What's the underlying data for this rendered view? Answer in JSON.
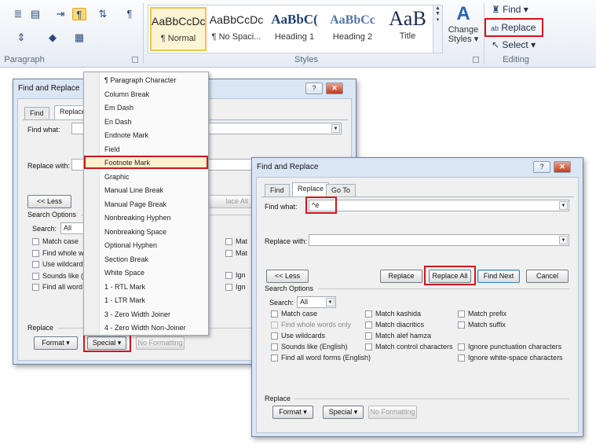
{
  "ribbon": {
    "paragraph": {
      "label": "Paragraph"
    },
    "styles": {
      "label": "Styles",
      "items": [
        {
          "sample": "AaBbCcDc",
          "name": "¶ Normal"
        },
        {
          "sample": "AaBbCcDc",
          "name": "¶ No Spaci..."
        },
        {
          "sample": "AaBbC(",
          "name": "Heading 1"
        },
        {
          "sample": "AaBbCc",
          "name": "Heading 2"
        },
        {
          "sample": "AaB",
          "name": "Title"
        }
      ],
      "change_styles_line1": "Change",
      "change_styles_line2": "Styles ▾"
    },
    "editing": {
      "label": "Editing",
      "find": "Find",
      "replace": "Replace",
      "select": "Select"
    },
    "colors": {
      "highlight_red": "#d2151b",
      "selected_style": "#f0c44c"
    }
  },
  "dialog_left": {
    "title": "Find and Replace",
    "tabs": [
      "Find",
      "Replace"
    ],
    "find_what_label": "Find what:",
    "replace_with_label": "Replace with:",
    "less_button": "<< Less",
    "replace_all_partial": "lace All",
    "search_options_label": "Search Options",
    "search_label": "Search:",
    "search_value": "All",
    "checkboxes": [
      "Match case",
      "Find whole wo",
      "Use wildcards",
      "Sounds like (E",
      "Find all word f"
    ],
    "right_checks": [
      "Mat",
      "Mat"
    ],
    "right_checks_2": [
      "Ign",
      "Ign"
    ],
    "replace_label": "Replace",
    "format_button": "Format ▾",
    "special_button": "Special ▾",
    "no_formatting_button": "No Formatting"
  },
  "menu": {
    "items": [
      "¶ Paragraph Character",
      "Column Break",
      "Em Dash",
      "En Dash",
      "Endnote Mark",
      "Field",
      "Footnote Mark",
      "Graphic",
      "Manual Line Break",
      "Manual Page Break",
      "Nonbreaking Hyphen",
      "Nonbreaking Space",
      "Optional Hyphen",
      "Section Break",
      "White Space",
      "1 - RTL Mark",
      "1 - LTR Mark",
      "3 - Zero Width Joiner",
      "4 - Zero Width Non-Joiner"
    ]
  },
  "dialog_right": {
    "title": "Find and Replace",
    "tabs": [
      "Find",
      "Replace",
      "Go To"
    ],
    "find_what_label": "Find what:",
    "find_what_value": "^e",
    "replace_with_label": "Replace with:",
    "less_button": "<< Less",
    "replace_button": "Replace",
    "replace_all_button": "Replace All",
    "find_next_button": "Find Next",
    "cancel_button": "Cancel",
    "search_options_label": "Search Options",
    "search_label": "Search:",
    "search_value": "All",
    "col1": [
      "Match case",
      "Find whole words only",
      "Use wildcards",
      "Sounds like (English)",
      "Find all word forms (English)"
    ],
    "col2": [
      "Match kashida",
      "Match diacritics",
      "Match alef hamza",
      "Match control characters"
    ],
    "col3": [
      "Match prefix",
      "Match suffix",
      "",
      "Ignore punctuation characters",
      "Ignore white-space characters"
    ],
    "replace_label": "Replace",
    "format_button": "Format ▾",
    "special_button": "Special ▾",
    "no_formatting_button": "No Formatting"
  }
}
